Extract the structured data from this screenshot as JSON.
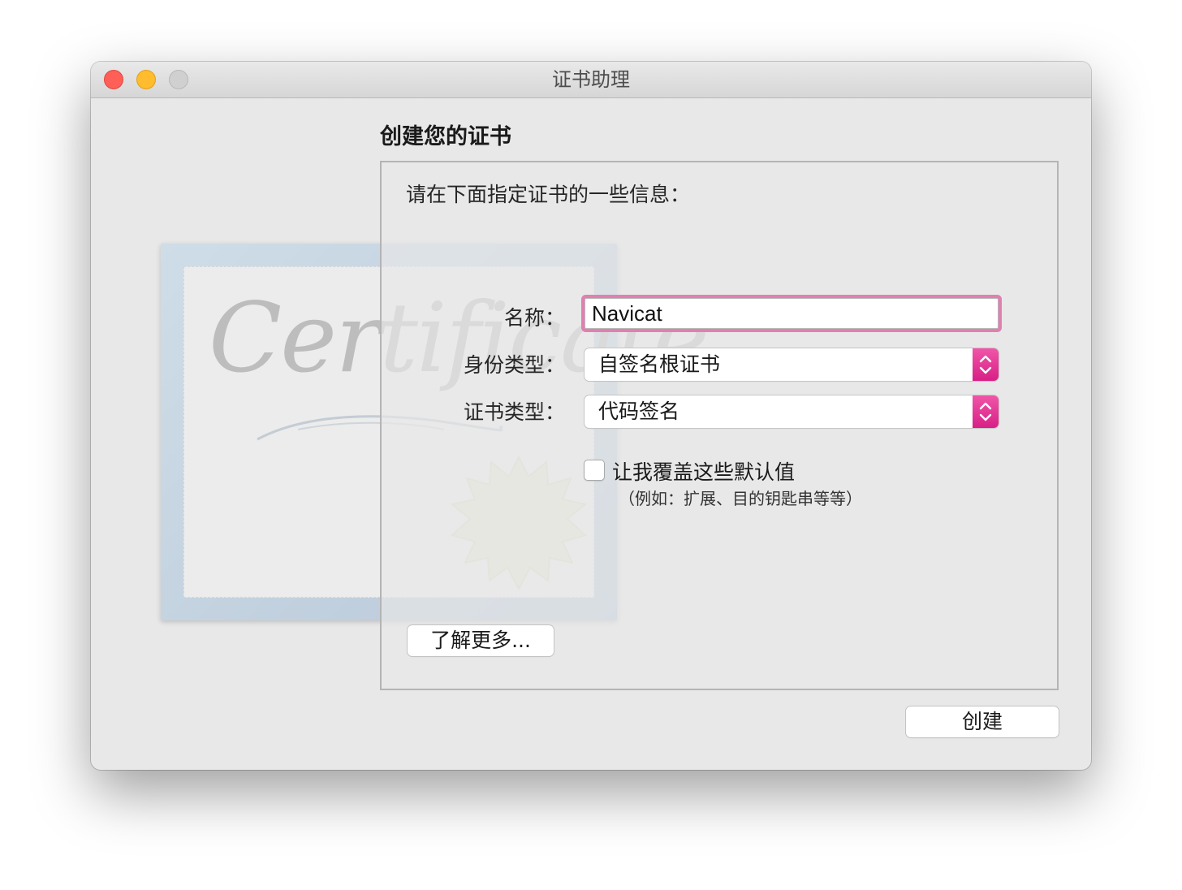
{
  "window": {
    "title": "证书助理"
  },
  "illustration": {
    "word": "Certificate"
  },
  "section": {
    "title": "创建您的证书",
    "instruction": "请在下面指定证书的一些信息："
  },
  "form": {
    "name_label": "名称：",
    "name_value": "Navicat",
    "identity_type_label": "身份类型：",
    "identity_type_value": "自签名根证书",
    "certificate_type_label": "证书类型：",
    "certificate_type_value": "代码签名",
    "override_label": "让我覆盖这些默认值",
    "override_hint": "（例如：扩展、目的钥匙串等等）",
    "override_checked": false
  },
  "buttons": {
    "learn_more": "了解更多...",
    "create": "创建"
  },
  "colors": {
    "accent": "#e0308f",
    "focus_ring": "#e37fb0",
    "close": "#fe5f57",
    "minimize": "#febc2e",
    "zoom_disabled": "#d0d0d0"
  }
}
